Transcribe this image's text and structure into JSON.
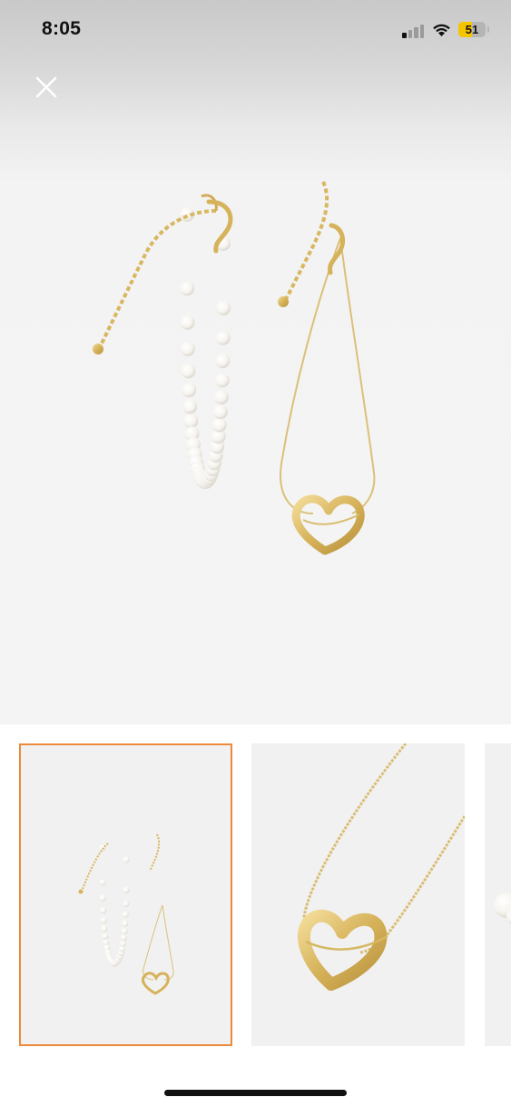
{
  "status_bar": {
    "time": "8:05",
    "battery_level": "51",
    "battery_color": "#f5c400",
    "signal_icon": "cellular-signal-icon",
    "wifi_icon": "wifi-icon"
  },
  "viewer": {
    "close_icon": "close-icon",
    "main_image": "pearl-and-gold-heart-bracelets-photo"
  },
  "thumbnails": [
    {
      "image": "pearl-and-gold-heart-bracelets-photo",
      "selected": true
    },
    {
      "image": "gold-heart-pendant-closeup-photo",
      "selected": false
    },
    {
      "image": "pearl-bracelet-partial-photo",
      "selected": false
    }
  ],
  "colors": {
    "selected_border": "#ec8a3b",
    "gold": "#d8b760",
    "pearl": "#ffffff"
  }
}
